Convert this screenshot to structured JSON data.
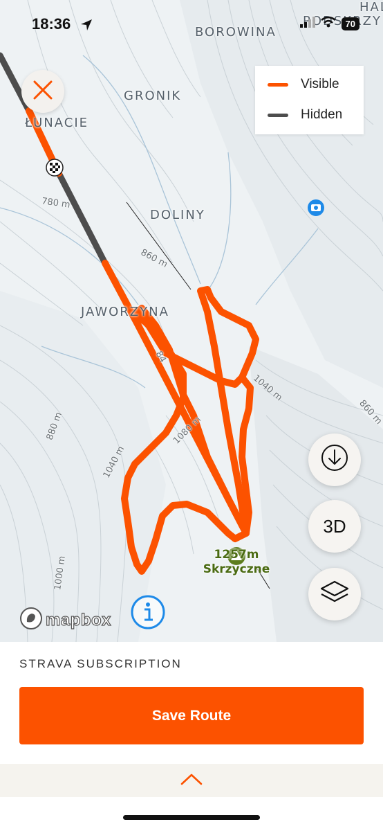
{
  "status_bar": {
    "time": "18:36",
    "battery": "70",
    "icons": [
      "location-arrow-icon",
      "signal-icon",
      "wifi-icon",
      "battery-icon"
    ]
  },
  "map": {
    "places": [
      "BOROWINA",
      "GRONIK",
      "ŁUNACIE",
      "DOLINY",
      "JAWORZYNA",
      "HALA",
      "PODSKRZY"
    ],
    "elevations": [
      "780 m",
      "860 m",
      "1040 m",
      "1080 m",
      "880 m",
      "1040 m",
      "1000 m",
      "860 m",
      "84"
    ],
    "peak": {
      "elevation": "1257m",
      "name": "Skrzyczne"
    },
    "attribution": "mapbox"
  },
  "legend": {
    "visible_label": "Visible",
    "hidden_label": "Hidden",
    "visible_color": "#fc5200",
    "hidden_color": "#4d4d4d"
  },
  "controls": {
    "close_icon": "close-icon",
    "download_icon": "download-icon",
    "three_d_label": "3D",
    "layers_icon": "layers-icon",
    "info_icon": "info-icon"
  },
  "bottom": {
    "subscription_label": "STRAVA SUBSCRIPTION",
    "save_label": "Save Route",
    "expand_icon": "chevron-up-icon",
    "accent": "#fc5200"
  }
}
